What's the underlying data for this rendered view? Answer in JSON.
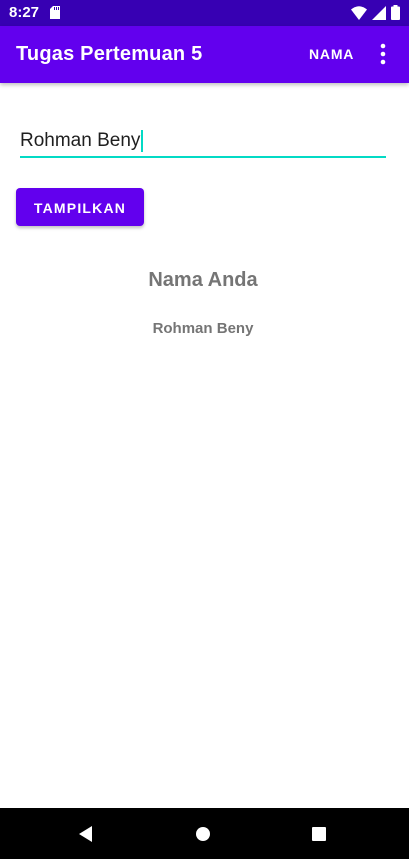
{
  "status_bar": {
    "time": "8:27",
    "icons": [
      "sd-card-icon",
      "wifi-icon",
      "signal-icon",
      "battery-icon"
    ]
  },
  "app_bar": {
    "title": "Tugas Pertemuan 5",
    "action_label": "NAMA",
    "overflow_icon": "more-vert-icon"
  },
  "form": {
    "input_value": "Rohman Beny",
    "button_label": "TAMPILKAN"
  },
  "result": {
    "heading": "Nama Anda",
    "name": "Rohman Beny"
  },
  "nav_bar": {
    "icons": [
      "back-icon",
      "home-icon",
      "recents-icon"
    ]
  },
  "colors": {
    "primary": "#6200ee",
    "primary_dark": "#3700b3",
    "accent": "#03dac5",
    "text_secondary": "#757575"
  }
}
